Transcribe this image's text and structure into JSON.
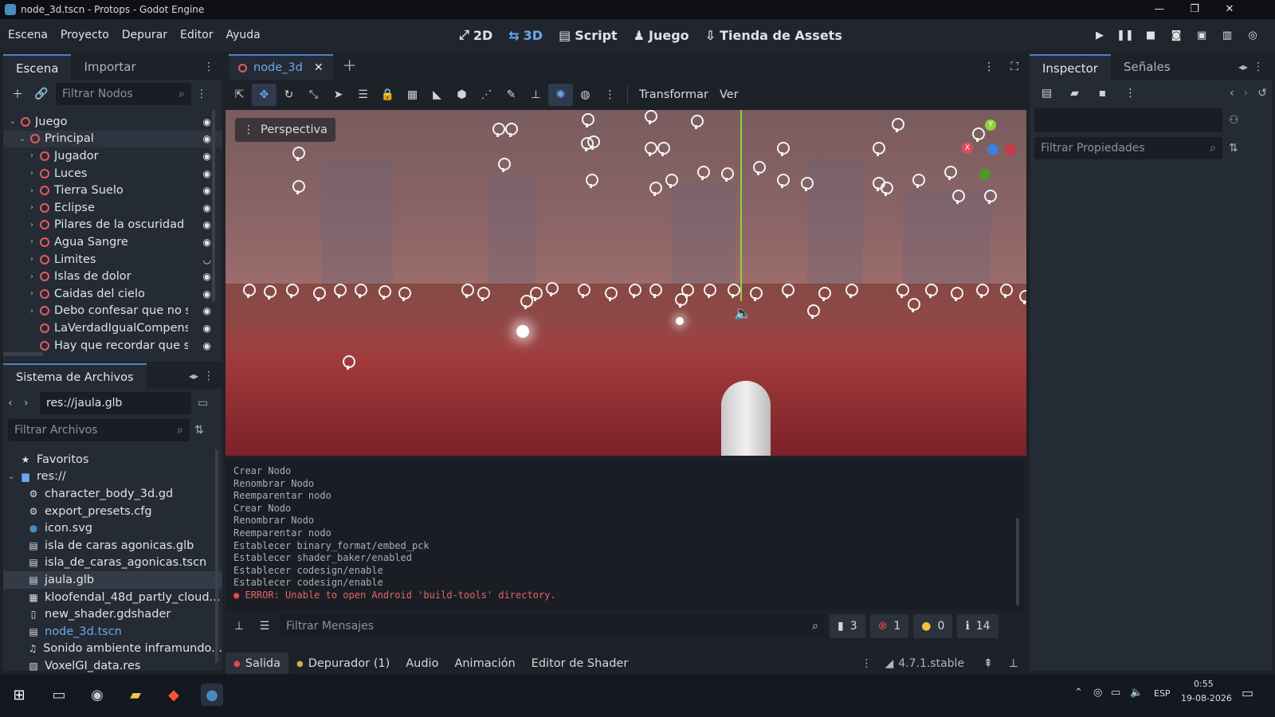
{
  "window": {
    "title": "node_3d.tscn - Protops - Godot Engine",
    "minimize": "—",
    "maximize": "❐",
    "close": "✕"
  },
  "menu": {
    "items": [
      "Escena",
      "Proyecto",
      "Depurar",
      "Editor",
      "Ayuda"
    ],
    "workspaces": [
      {
        "icon": "2d-icon",
        "label": "2D"
      },
      {
        "icon": "3d-icon",
        "label": "3D"
      },
      {
        "icon": "script-icon",
        "label": "Script"
      },
      {
        "icon": "game-icon",
        "label": "Juego"
      },
      {
        "icon": "assetlib-icon",
        "label": "Tienda de Assets"
      }
    ]
  },
  "scene_dock": {
    "tabs": [
      "Escena",
      "Importar"
    ],
    "filter_placeholder": "Filtrar Nodos",
    "nodes": [
      {
        "label": "Juego",
        "depth": 0,
        "arrow": "v",
        "visible": true
      },
      {
        "label": "Principal",
        "depth": 1,
        "arrow": "v",
        "visible": true,
        "selected": true
      },
      {
        "label": "Jugador",
        "depth": 2,
        "arrow": ">",
        "visible": true
      },
      {
        "label": "Luces",
        "depth": 2,
        "arrow": ">",
        "visible": true
      },
      {
        "label": "Tierra Suelo",
        "depth": 2,
        "arrow": ">",
        "visible": true
      },
      {
        "label": "Eclipse",
        "depth": 2,
        "arrow": ">",
        "visible": true
      },
      {
        "label": "Pilares de la oscuridad",
        "depth": 2,
        "arrow": ">",
        "visible": true
      },
      {
        "label": "Agua Sangre",
        "depth": 2,
        "arrow": ">",
        "visible": true
      },
      {
        "label": "Limites",
        "depth": 2,
        "arrow": ">",
        "visible": false
      },
      {
        "label": "Islas de dolor",
        "depth": 2,
        "arrow": ">",
        "visible": true
      },
      {
        "label": "Caidas del cielo",
        "depth": 2,
        "arrow": ">",
        "visible": true
      },
      {
        "label": "Debo confesar que no se",
        "depth": 2,
        "arrow": ">",
        "visible": true
      },
      {
        "label": "LaVerdadIgualCompensa",
        "depth": 2,
        "arrow": "",
        "visible": true
      },
      {
        "label": "Hay que recordar que sh",
        "depth": 2,
        "arrow": "",
        "visible": true
      }
    ]
  },
  "filesystem": {
    "title": "Sistema de Archivos",
    "path": "res://jaula.glb",
    "filter_placeholder": "Filtrar Archivos",
    "items": [
      {
        "label": "Favoritos",
        "icon": "star-icon",
        "glyph": "★",
        "depth": 0
      },
      {
        "label": "res://",
        "icon": "folder-icon",
        "glyph": "▆",
        "depth": 0,
        "arrow": "v"
      },
      {
        "label": "character_body_3d.gd",
        "icon": "gear-icon",
        "glyph": "⚙",
        "depth": 1
      },
      {
        "label": "export_presets.cfg",
        "icon": "gear-icon",
        "glyph": "⚙",
        "depth": 1
      },
      {
        "label": "icon.svg",
        "icon": "godot-icon",
        "glyph": "●",
        "depth": 1
      },
      {
        "label": "isla de caras agonicas.glb",
        "icon": "scene-icon",
        "glyph": "▤",
        "depth": 1
      },
      {
        "label": "isla_de_caras_agonicas.tscn",
        "icon": "scene-icon",
        "glyph": "▤",
        "depth": 1
      },
      {
        "label": "jaula.glb",
        "icon": "scene-icon",
        "glyph": "▤",
        "depth": 1,
        "selected": true
      },
      {
        "label": "kloofendal_48d_partly_cloud...",
        "icon": "image-icon",
        "glyph": "▦",
        "depth": 1
      },
      {
        "label": "new_shader.gdshader",
        "icon": "file-icon",
        "glyph": "▯",
        "depth": 1
      },
      {
        "label": "node_3d.tscn",
        "icon": "scene-icon",
        "glyph": "▤",
        "depth": 1,
        "link": true
      },
      {
        "label": "Sonido ambiente inframundo...",
        "icon": "audio-icon",
        "glyph": "♫",
        "depth": 1
      },
      {
        "label": "VoxelGI_data.res",
        "icon": "resource-icon",
        "glyph": "▧",
        "depth": 1
      }
    ]
  },
  "editor": {
    "scene_tab": "node_3d",
    "toolbar_menus": [
      "Transformar",
      "Ver"
    ],
    "viewport_label": "Perspectiva"
  },
  "output": {
    "lines": [
      "Crear Nodo",
      "Renombrar Nodo",
      "Reemparentar nodo",
      "Crear Nodo",
      "Renombrar Nodo",
      "Reemparentar nodo",
      "Establecer binary_format/embed_pck",
      "Establecer shader_baker/enabled",
      "Establecer codesign/enable",
      "Establecer codesign/enable"
    ],
    "error": "ERROR: Unable to open Android 'build-tools' directory.",
    "filter_placeholder": "Filtrar Mensajes",
    "counts": {
      "messages": "3",
      "errors": "1",
      "warnings": "0",
      "info": "14"
    }
  },
  "bottom_panel": {
    "tabs": [
      "Salida",
      "Depurador (1)",
      "Audio",
      "Animación",
      "Editor de Shader"
    ],
    "version": "4.7.1.stable"
  },
  "inspector": {
    "tabs": [
      "Inspector",
      "Señales"
    ],
    "filter_placeholder": "Filtrar Propiedades"
  },
  "taskbar": {
    "language": "ESP",
    "time": "0:55",
    "date": "19-08-2026"
  },
  "colors": {
    "accent": "#4d7fcc",
    "node_icon": "#e25c5c",
    "error": "#e46464"
  }
}
